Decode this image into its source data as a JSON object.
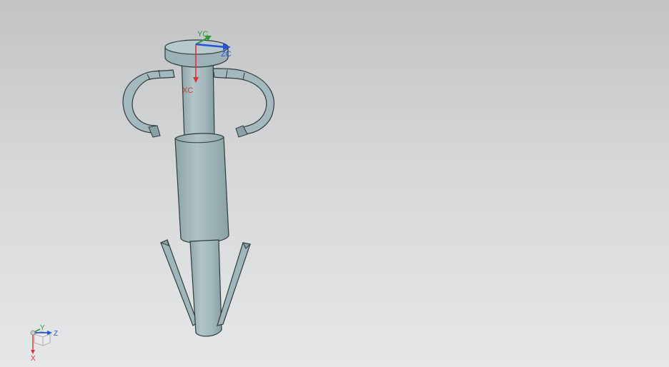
{
  "viewport": {
    "background_top": "#c2c3c4",
    "background_bottom": "#e6e7e8"
  },
  "model": {
    "body_color": "#a6bcc0",
    "shade_color": "#8aa2a7",
    "edge_color": "#2f3a3c"
  },
  "wcs": {
    "x_label": "XC",
    "y_label": "YC",
    "z_label": "ZC",
    "x_color": "#d9343a",
    "y_color": "#2e9a35",
    "z_color": "#2a52d6"
  },
  "view_triad": {
    "x_label": "X",
    "y_label": "Y",
    "z_label": "Z",
    "x_color": "#d9343a",
    "y_color": "#2e9a35",
    "z_color": "#2a52d6"
  }
}
